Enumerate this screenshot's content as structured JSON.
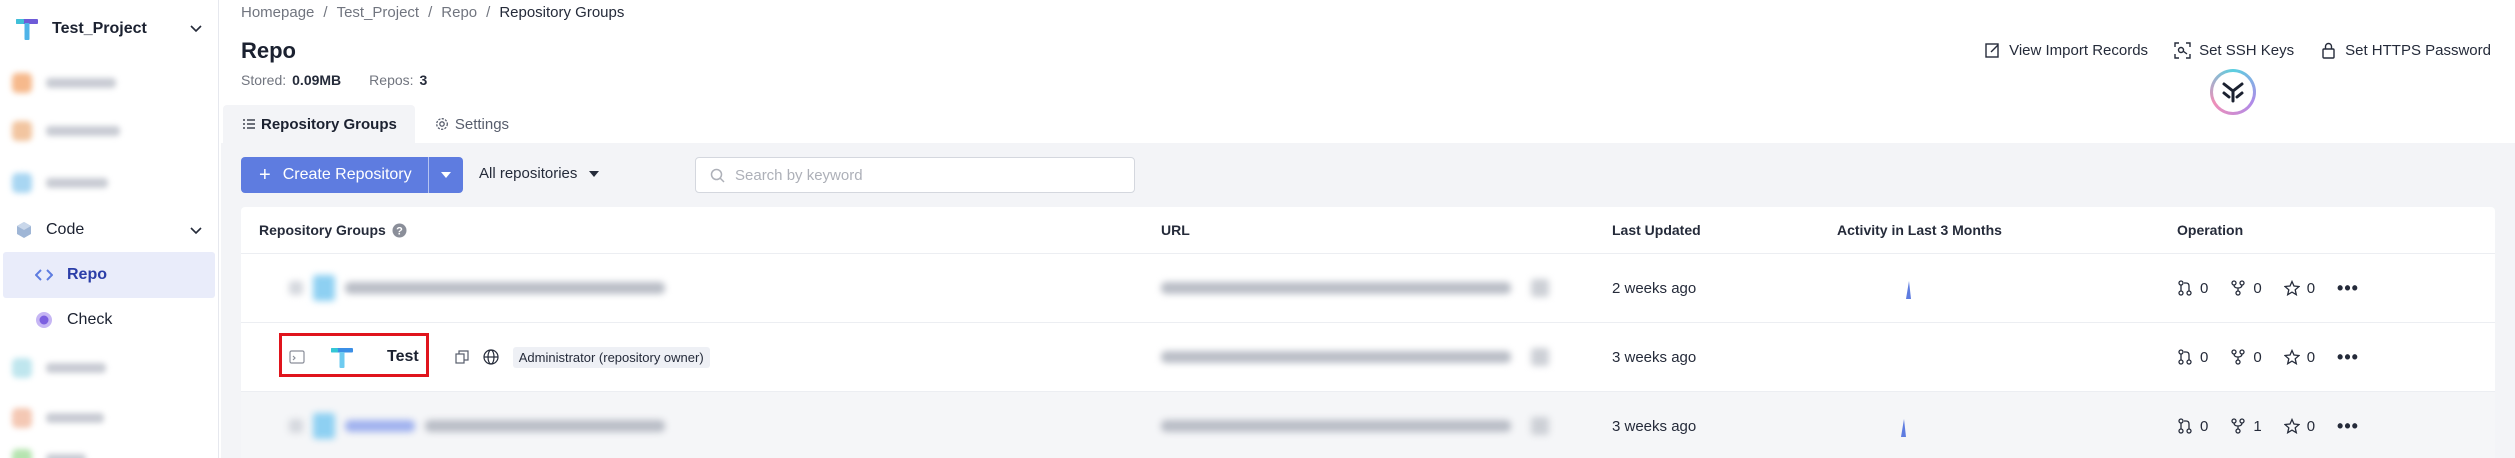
{
  "sidebar": {
    "project_name": "Test_Project",
    "code_label": "Code",
    "repo_label": "Repo",
    "check_label": "Check"
  },
  "breadcrumb": [
    "Homepage",
    "Test_Project",
    "Repo",
    "Repository Groups"
  ],
  "header": {
    "title": "Repo",
    "stored_label": "Stored:",
    "stored_value": "0.09MB",
    "repos_label": "Repos:",
    "repos_value": "3",
    "actions": {
      "import_records": "View Import Records",
      "ssh_keys": "Set SSH Keys",
      "https_password": "Set HTTPS Password"
    }
  },
  "tabs": [
    {
      "label": "Repository Groups",
      "active": true
    },
    {
      "label": "Settings",
      "active": false
    }
  ],
  "toolbar": {
    "create_label": "Create Repository",
    "filter_value": "All repositories",
    "search_placeholder": "Search by keyword"
  },
  "table": {
    "columns": [
      "Repository Groups",
      "URL",
      "Last Updated",
      "Activity in Last 3 Months",
      "Operation"
    ],
    "rows": [
      {
        "name": "",
        "updated": "2 weeks ago",
        "mr": "0",
        "forks": "0",
        "stars": "0"
      },
      {
        "name": "Test",
        "badge": "Administrator (repository owner)",
        "updated": "3 weeks ago",
        "mr": "0",
        "forks": "0",
        "stars": "0"
      },
      {
        "name": "",
        "updated": "3 weeks ago",
        "mr": "0",
        "forks": "1",
        "stars": "0"
      }
    ]
  },
  "colors": {
    "primary": "#5e7ce0",
    "highlight": "#e0141c",
    "nav_active_bg": "#e9ecfa"
  }
}
